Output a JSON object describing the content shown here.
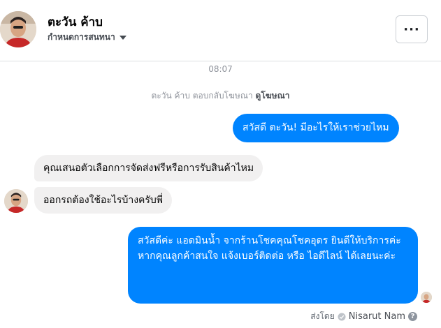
{
  "header": {
    "name": "ตะวัน ค้าบ",
    "subtitle": "กำหนดการสนทนา",
    "more_label": "···"
  },
  "thread": {
    "time": "08:07",
    "reply_note": "ตะวัน ค้าบ ตอบกลับโฆษณา",
    "reply_link": "ดูโฆษณา",
    "messages": [
      {
        "from": "page",
        "text": "สวัสดี ตะวัน! มีอะไรให้เราช่วยไหม"
      },
      {
        "from": "user",
        "text": "คุณเสนอตัวเลือกการจัดส่งฟรีหรือการรับสินค้าไหม"
      },
      {
        "from": "user",
        "text": "ออกรถต้องใช้อะไรบ้างครับพี่"
      },
      {
        "from": "page",
        "text_line1": "สวัสดีค่ะ แอดมินน้ำ จากร้านโชคคุณโชคอุดร ยินดีให้บริการค่ะ",
        "text_line2": "หากคุณลูกค้าสนใจ แจ้งเบอร์ติดต่อ หรือ ไอดีไลน์ ได้เลยนะค่ะ"
      }
    ],
    "sent_by_label": "ส่งโดย",
    "sent_by_name": "Nisarut Nam",
    "help_icon": "?"
  },
  "colors": {
    "accent": "#0084ff",
    "incoming_bubble": "#f1f0f0"
  },
  "icons": {
    "subtitle_caret": "caret-down-icon",
    "sender_badge": "check-circle-icon",
    "help": "question-circle-icon"
  }
}
